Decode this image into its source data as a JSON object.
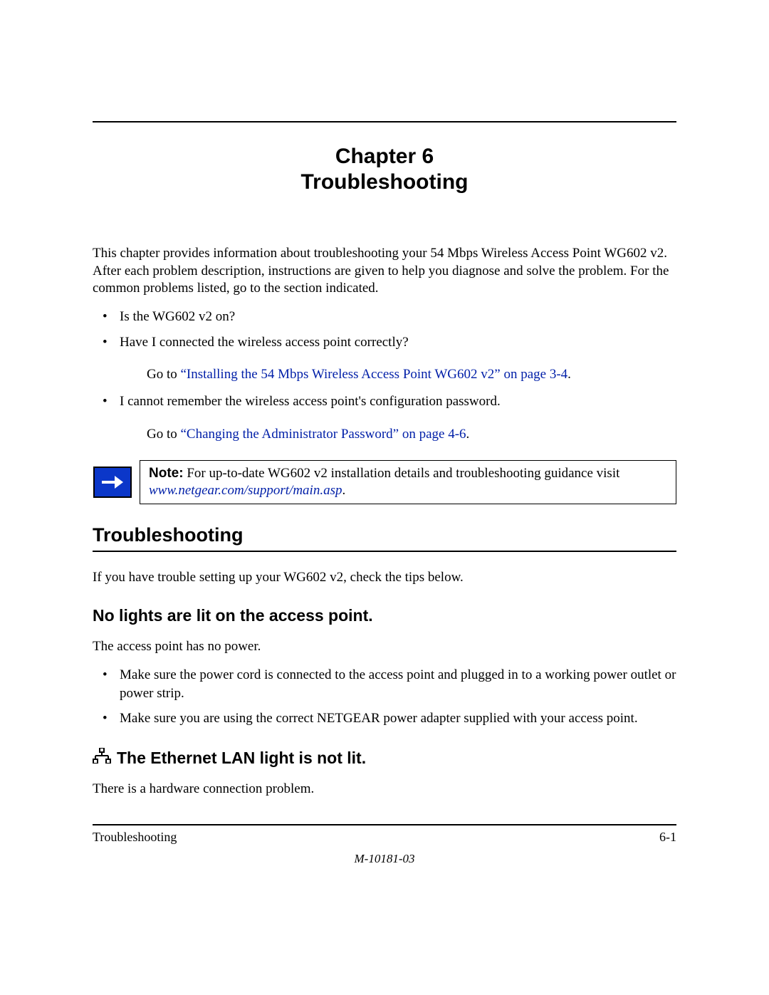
{
  "chapter": {
    "line1": "Chapter 6",
    "line2": "Troubleshooting"
  },
  "intro": "This chapter provides information about troubleshooting your 54 Mbps Wireless Access Point WG602 v2. After each problem description, instructions are given to help you diagnose and solve the problem. For the common problems listed, go to the section indicated.",
  "bullets": {
    "b1": "Is the WG602 v2 on?",
    "b2": "Have I connected the wireless access point correctly?",
    "b2_goto_prefix": "Go to ",
    "b2_link": "“Installing the 54 Mbps Wireless Access Point WG602 v2” on page 3-4",
    "b2_suffix": ".",
    "b3": "I cannot remember the wireless access point's configuration password.",
    "b3_goto_prefix": "Go to ",
    "b3_link": "“Changing the Administrator Password” on page 4-6",
    "b3_suffix": "."
  },
  "note": {
    "label": "Note:",
    "text": " For up-to-date WG602 v2 installation details and troubleshooting guidance visit ",
    "url": "www.netgear.com/support/main.asp",
    "suffix": "."
  },
  "section1": {
    "heading": "Troubleshooting",
    "intro": "If you have trouble setting up your WG602 v2, check the tips below."
  },
  "sub1": {
    "heading": "No lights are lit on the access point.",
    "lead": "The access point has no power.",
    "items": {
      "i1": "Make sure the power cord is connected to the access point and plugged in to a working power outlet or power strip.",
      "i2": "Make sure you are using the correct NETGEAR power adapter supplied with your access point."
    }
  },
  "sub2": {
    "heading": "The Ethernet LAN light is not lit.",
    "lead": "There is a hardware connection problem."
  },
  "footer": {
    "left": "Troubleshooting",
    "right": "6-1",
    "docid": "M-10181-03"
  }
}
